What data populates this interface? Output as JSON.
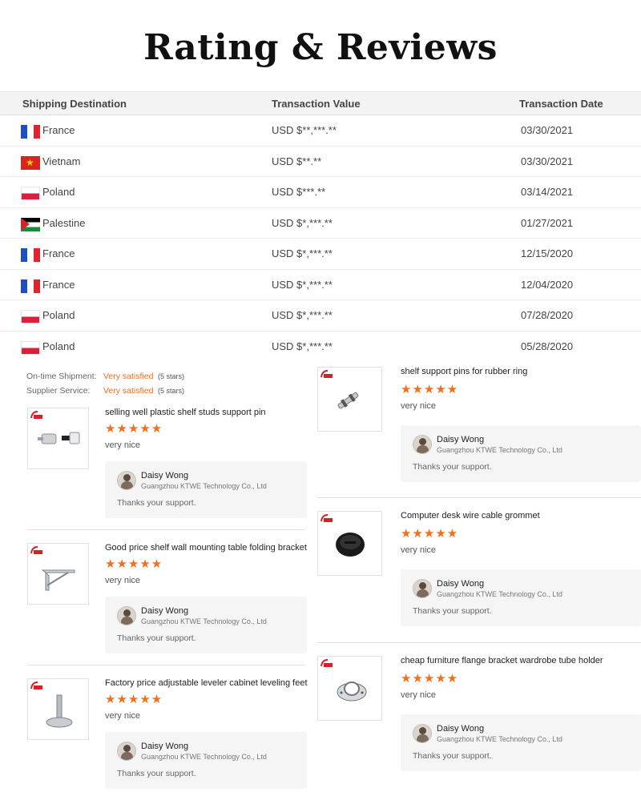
{
  "title": "Rating & Reviews",
  "table": {
    "headers": {
      "destination": "Shipping Destination",
      "value": "Transaction Value",
      "date": "Transaction Date"
    },
    "rows": [
      {
        "country": "France",
        "flag": "flag-france-icon",
        "value": "USD $**,***.**",
        "date": "03/30/2021"
      },
      {
        "country": "Vietnam",
        "flag": "flag-vietnam-icon",
        "value": "USD $**.**",
        "date": "03/30/2021"
      },
      {
        "country": "Poland",
        "flag": "flag-poland-icon",
        "value": "USD $***.**",
        "date": "03/14/2021"
      },
      {
        "country": "Palestine",
        "flag": "flag-palestine-icon",
        "value": "USD $*,***.**",
        "date": "01/27/2021"
      },
      {
        "country": "France",
        "flag": "flag-france-icon",
        "value": "USD $*,***.**",
        "date": "12/15/2020"
      },
      {
        "country": "France",
        "flag": "flag-france-icon",
        "value": "USD $*,***.**",
        "date": "12/04/2020"
      },
      {
        "country": "Poland",
        "flag": "flag-poland-icon",
        "value": "USD $*,***.**",
        "date": "07/28/2020"
      },
      {
        "country": "Poland",
        "flag": "flag-poland-icon",
        "value": "USD $*,***.**",
        "date": "05/28/2020"
      }
    ]
  },
  "ratings": {
    "shipment": {
      "label": "On-time Shipment:",
      "value": "Very satisfied",
      "stars": "(5 stars)"
    },
    "service": {
      "label": "Supplier Service:",
      "value": "Very satisfied",
      "stars": "(5 stars)"
    }
  },
  "reviews": [
    {
      "product": "selling well plastic shelf studs support pin",
      "stars": "★★★★★",
      "rating": 5,
      "comment": "very nice",
      "reply": {
        "name": "Daisy Wong",
        "company": "Guangzhou KTWE Technology Co., Ltd",
        "text": "Thanks your support."
      }
    },
    {
      "product": "Good price shelf wall mounting table folding bracket",
      "stars": "★★★★★",
      "rating": 5,
      "comment": "very nice",
      "reply": {
        "name": "Daisy Wong",
        "company": "Guangzhou KTWE Technology Co., Ltd",
        "text": "Thanks your support."
      }
    },
    {
      "product": "Factory price adjustable leveler cabinet leveling feet",
      "stars": "★★★★★",
      "rating": 5,
      "comment": "very nice",
      "reply": {
        "name": "Daisy Wong",
        "company": "Guangzhou KTWE Technology Co., Ltd",
        "text": "Thanks your support."
      }
    },
    {
      "product": "shelf support pins for rubber ring",
      "stars": "★★★★★",
      "rating": 5,
      "comment": "very nice",
      "reply": {
        "name": "Daisy Wong",
        "company": "Guangzhou KTWE Technology Co., Ltd",
        "text": "Thanks your support."
      }
    },
    {
      "product": "Computer desk wire cable grommet",
      "stars": "★★★★★",
      "rating": 5,
      "comment": "very nice",
      "reply": {
        "name": "Daisy Wong",
        "company": "Guangzhou KTWE Technology Co., Ltd",
        "text": "Thanks your support."
      }
    },
    {
      "product": "cheap furniture flange bracket wardrobe tube holder",
      "stars": "★★★★★",
      "rating": 5,
      "comment": "very nice",
      "reply": {
        "name": "Daisy Wong",
        "company": "Guangzhou KTWE Technology Co., Ltd",
        "text": "Thanks your support."
      }
    }
  ],
  "colors": {
    "accent": "#f0701c",
    "header_bg": "#f3f3f3",
    "reply_bg": "#f5f5f5"
  }
}
